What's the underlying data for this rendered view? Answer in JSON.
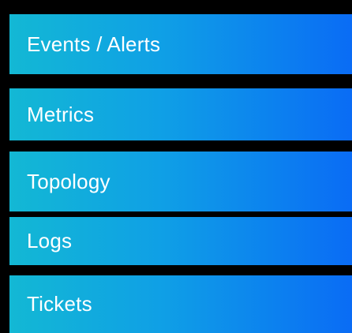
{
  "menu": {
    "items": [
      {
        "label": "Events / Alerts"
      },
      {
        "label": "Metrics"
      },
      {
        "label": "Topology"
      },
      {
        "label": "Logs"
      },
      {
        "label": "Tickets"
      }
    ]
  },
  "colors": {
    "background": "#000000",
    "gradient_start": "#13b8d4",
    "gradient_end": "#0a6cf5",
    "text": "#ffffff"
  }
}
